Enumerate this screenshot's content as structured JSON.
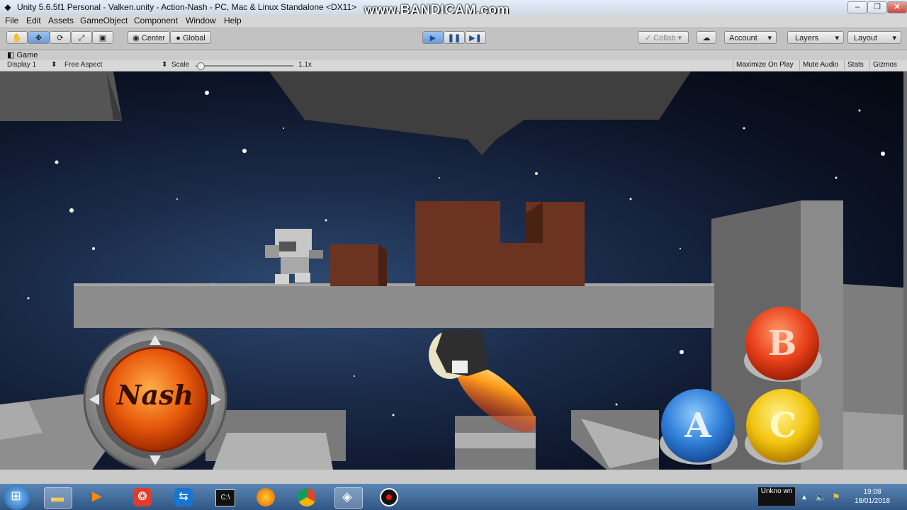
{
  "window": {
    "title": "Unity 5.6.5f1 Personal - Valken.unity - Action-Nash - PC, Mac & Linux Standalone <DX11>",
    "watermark": "www.BANDICAM.com",
    "controls": [
      "–",
      "❐",
      "✕"
    ]
  },
  "menu": [
    "File",
    "Edit",
    "Assets",
    "GameObject",
    "Component",
    "Window",
    "Help"
  ],
  "toolbar": {
    "tools": [
      "hand-tool",
      "move-tool",
      "rotate-tool",
      "scale-tool",
      "rect-tool"
    ],
    "pivot_label": "Center",
    "space_label": "Global",
    "collab_label": "Collab ▾",
    "account_label": "Account",
    "layers_label": "Layers",
    "layout_label": "Layout"
  },
  "game_tab": {
    "label": "Game",
    "display": "Display 1",
    "aspect": "Free Aspect",
    "scale_label": "Scale",
    "scale_value": "1.1x",
    "scale_fraction": 0.05,
    "buttons": [
      "Maximize On Play",
      "Mute Audio",
      "Stats",
      "Gizmos"
    ]
  },
  "game": {
    "joystick_label": "Nash",
    "button_a": "A",
    "button_b": "B",
    "button_c": "C"
  },
  "taskbar": {
    "tray_label": "Unkno wn",
    "time": "19:08",
    "date": "18/01/2018"
  },
  "colors": {
    "play_active": "#6a9ad8",
    "platform": "#8c8c8c",
    "crate": "#6b3320",
    "button_a": "#2f7ed8",
    "button_b": "#e8401a",
    "button_c": "#f2c40f",
    "joystick": "#e85a0c"
  }
}
